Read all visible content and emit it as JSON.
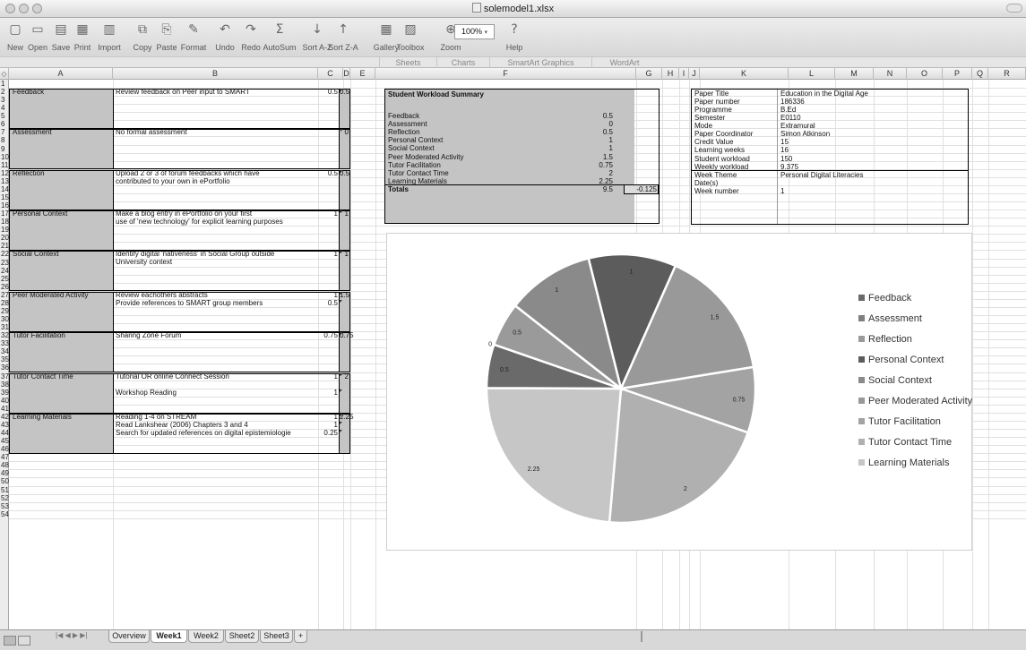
{
  "window": {
    "title": "solemodel1.xlsx"
  },
  "toolbar": {
    "buttons": [
      "New",
      "Open",
      "Save",
      "Print",
      "Import",
      "Copy",
      "Paste",
      "Format",
      "Undo",
      "Redo",
      "AutoSum",
      "Sort A-Z",
      "Sort Z-A",
      "Gallery",
      "Toolbox",
      "Zoom",
      "Help"
    ],
    "zoom_value": "100%"
  },
  "ribbon": {
    "tabs": [
      "Sheets",
      "Charts",
      "SmartArt Graphics",
      "WordArt"
    ]
  },
  "columns": [
    "A",
    "B",
    "C",
    "D",
    "E",
    "F",
    "G",
    "H",
    "I",
    "J",
    "K",
    "L",
    "M",
    "N",
    "O",
    "P",
    "Q",
    "R"
  ],
  "rows": [
    "1",
    "2",
    "3",
    "4",
    "5",
    "6",
    "7",
    "8",
    "9",
    "10",
    "11",
    "12",
    "13",
    "14",
    "15",
    "16",
    "17",
    "18",
    "19",
    "20",
    "21",
    "22",
    "23",
    "24",
    "25",
    "26",
    "27",
    "28",
    "29",
    "30",
    "31",
    "32",
    "33",
    "34",
    "35",
    "36",
    "37",
    "38",
    "39",
    "40",
    "41",
    "42",
    "43",
    "44",
    "45",
    "46",
    "47",
    "48",
    "49",
    "50",
    "51",
    "52",
    "53",
    "54"
  ],
  "activities": [
    {
      "category": "Feedback",
      "lines": [
        {
          "text": "Review feedback on Peer input to SMART",
          "c": "0.5"
        }
      ],
      "d": "0.5"
    },
    {
      "category": "Assessment",
      "lines": [
        {
          "text": "No formal assessment",
          "c": ""
        }
      ],
      "d": "0"
    },
    {
      "category": "Reflection",
      "lines": [
        {
          "text": "Upload 2 or 3 of forum feedbacks which have",
          "c": "0.5"
        },
        {
          "text": "contributed to your own in ePortfolio",
          "c": ""
        }
      ],
      "d": "0.5"
    },
    {
      "category": "Personal Context",
      "lines": [
        {
          "text": "Make a blog entry in ePortfolio on your first",
          "c": "1"
        },
        {
          "text": "use of 'new technology' for explicit learning purposes",
          "c": ""
        }
      ],
      "d": "1"
    },
    {
      "category": "Social Context",
      "lines": [
        {
          "text": "Identify digital 'nativeness' in Social Group outside",
          "c": "1"
        },
        {
          "text": "University context",
          "c": ""
        }
      ],
      "d": "1"
    },
    {
      "category": "Peer Moderated Activity",
      "lines": [
        {
          "text": "Review eachothers abstracts",
          "c": "1"
        },
        {
          "text": "Provide references to SMART group members",
          "c": "0.5"
        }
      ],
      "d": "1.5"
    },
    {
      "category": "Tutor Facilitation",
      "lines": [
        {
          "text": "Sharing Zone Forum",
          "c": "0.75"
        }
      ],
      "d": "0.75"
    },
    {
      "category": "Tutor Contact Time",
      "lines": [
        {
          "text": "Tutorial OR online Connect Session",
          "c": "1"
        },
        {
          "text": "",
          "c": ""
        },
        {
          "text": "Workshop Reading",
          "c": "1"
        }
      ],
      "d": "2"
    },
    {
      "category": "Learning Materials",
      "lines": [
        {
          "text": "Reading 1-4 on STREAM",
          "c": "1"
        },
        {
          "text": "Read Lankshear (2006) Chapters 3 and 4",
          "c": "1"
        },
        {
          "text": "Search for updated references on digital epistemiologie",
          "c": "0.25"
        }
      ],
      "d": "2.25"
    }
  ],
  "summary": {
    "title": "Student Workload Summary",
    "rows": [
      {
        "label": "Feedback",
        "value": "0.5"
      },
      {
        "label": "Assessment",
        "value": "0"
      },
      {
        "label": "Reflection",
        "value": "0.5"
      },
      {
        "label": "Personal Context",
        "value": "1"
      },
      {
        "label": "Social Context",
        "value": "1"
      },
      {
        "label": "Peer Moderated Activity",
        "value": "1.5"
      },
      {
        "label": "Tutor Facilitation",
        "value": "0.75"
      },
      {
        "label": "Tutor Contact Time",
        "value": "2"
      },
      {
        "label": "Learning Materials",
        "value": "2.25"
      }
    ],
    "totals_label": "Totals",
    "totals_value": "9.5",
    "totals_diff": "-0.125"
  },
  "paper_info": [
    {
      "label": "Paper Title",
      "value": "Education in the Digital Age"
    },
    {
      "label": "Paper number",
      "value": "186336"
    },
    {
      "label": "Programme",
      "value": "B.Ed"
    },
    {
      "label": "Semester",
      "value": "E0110"
    },
    {
      "label": "Mode",
      "value": "Extramural"
    },
    {
      "label": "Paper Coordinator",
      "value": "Simon Atkinson"
    },
    {
      "label": "Credit Value",
      "value": "15"
    },
    {
      "label": "Learning weeks",
      "value": "16"
    },
    {
      "label": "Student workload",
      "value": "150"
    },
    {
      "label": "Weekly workload",
      "value": "9.375"
    }
  ],
  "week_info": [
    {
      "label": "Week Theme",
      "value": "Personal Digital Literacies"
    },
    {
      "label": "Date(s)",
      "value": ""
    },
    {
      "label": "Week number",
      "value": "1"
    }
  ],
  "chart_data": {
    "type": "pie",
    "slices": [
      {
        "label": "Feedback",
        "value": 0.5,
        "color": "#6a6a6a",
        "display": "0.5"
      },
      {
        "label": "Assessment",
        "value": 0,
        "color": "#7f7f7f",
        "display": "0"
      },
      {
        "label": "Reflection",
        "value": 0.5,
        "color": "#9a9a9a",
        "display": "0.5"
      },
      {
        "label": "Personal Context",
        "value": 1,
        "color": "#5c5c5c",
        "display": "1"
      },
      {
        "label": "Social Context",
        "value": 1,
        "color": "#8a8a8a",
        "display": "1"
      },
      {
        "label": "Peer Moderated Activity",
        "value": 1.5,
        "color": "#999999",
        "display": "1.5"
      },
      {
        "label": "Tutor Facilitation",
        "value": 0.75,
        "color": "#a3a3a3",
        "display": "0.75"
      },
      {
        "label": "Tutor Contact Time",
        "value": 2,
        "color": "#b0b0b0",
        "display": "2"
      },
      {
        "label": "Learning Materials",
        "value": 2.25,
        "color": "#c6c6c6",
        "display": "2.25"
      }
    ],
    "legend_position": "right"
  },
  "sheet_tabs": [
    {
      "label": "Overview",
      "active": false
    },
    {
      "label": "Week1",
      "active": true
    },
    {
      "label": "Week2",
      "active": false
    },
    {
      "label": "Sheet2",
      "active": false
    },
    {
      "label": "Sheet3",
      "active": false
    }
  ],
  "add_sheet_label": "+",
  "nav_arrows": "|◀ ◀ ▶ ▶|"
}
